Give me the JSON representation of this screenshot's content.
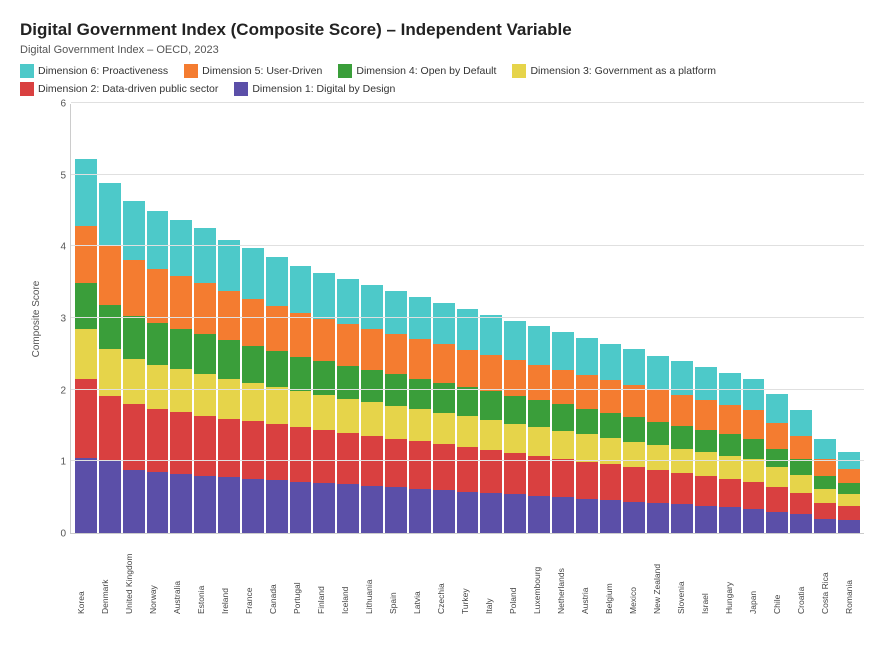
{
  "title": "Digital Government Index (Composite Score) – Independent Variable",
  "subtitle": "Digital Government Index – OECD, 2023",
  "legend": [
    {
      "label": "Dimension 6: Proactiveness",
      "color": "#4dc9c9"
    },
    {
      "label": "Dimension 5: User-Driven",
      "color": "#f47c30"
    },
    {
      "label": "Dimension 4: Open by Default",
      "color": "#3a9e3a"
    },
    {
      "label": "Dimension 3: Government as a platform",
      "color": "#e6d44a"
    },
    {
      "label": "Dimension 2: Data-driven public sector",
      "color": "#d94040"
    },
    {
      "label": "Dimension 1: Digital by Design",
      "color": "#5b4fa8"
    }
  ],
  "yAxis": {
    "label": "Composite Score",
    "ticks": [
      0,
      1,
      2,
      3,
      4,
      5,
      6
    ],
    "max": 6
  },
  "countries": [
    "Korea",
    "Denmark",
    "United Kingdom",
    "Norway",
    "Australia",
    "Estonia",
    "Ireland",
    "France",
    "Canada",
    "Portugal",
    "Finland",
    "Iceland",
    "Lithuania",
    "Spain",
    "Latvia",
    "Czechia",
    "Turkey",
    "Italy",
    "Poland",
    "Luxembourg",
    "Netherlands",
    "Austria",
    "Belgium",
    "Mexico",
    "New Zealand",
    "Slovenia",
    "Israel",
    "Hungary",
    "Japan",
    "Chile",
    "Croatia",
    "Costa Rica",
    "Romania"
  ],
  "bars": [
    {
      "country": "Korea",
      "d6": 0.93,
      "d5": 0.8,
      "d4": 0.65,
      "d3": 0.7,
      "d2": 1.1,
      "d1": 1.05
    },
    {
      "country": "Denmark",
      "d6": 0.88,
      "d5": 0.82,
      "d4": 0.62,
      "d3": 0.65,
      "d2": 0.9,
      "d1": 1.02
    },
    {
      "country": "United Kingdom",
      "d6": 0.82,
      "d5": 0.78,
      "d4": 0.6,
      "d3": 0.64,
      "d2": 0.92,
      "d1": 0.88
    },
    {
      "country": "Norway",
      "d6": 0.8,
      "d5": 0.76,
      "d4": 0.59,
      "d3": 0.62,
      "d2": 0.88,
      "d1": 0.85
    },
    {
      "country": "Australia",
      "d6": 0.78,
      "d5": 0.74,
      "d4": 0.57,
      "d3": 0.6,
      "d2": 0.86,
      "d1": 0.83
    },
    {
      "country": "Estonia",
      "d6": 0.76,
      "d5": 0.72,
      "d4": 0.56,
      "d3": 0.58,
      "d2": 0.84,
      "d1": 0.8
    },
    {
      "country": "Ireland",
      "d6": 0.72,
      "d5": 0.68,
      "d4": 0.54,
      "d3": 0.56,
      "d2": 0.82,
      "d1": 0.78
    },
    {
      "country": "France",
      "d6": 0.7,
      "d5": 0.66,
      "d4": 0.52,
      "d3": 0.54,
      "d2": 0.8,
      "d1": 0.76
    },
    {
      "country": "Canada",
      "d6": 0.68,
      "d5": 0.64,
      "d4": 0.5,
      "d3": 0.52,
      "d2": 0.78,
      "d1": 0.74
    },
    {
      "country": "Portugal",
      "d6": 0.65,
      "d5": 0.62,
      "d4": 0.48,
      "d3": 0.5,
      "d2": 0.76,
      "d1": 0.72
    },
    {
      "country": "Finland",
      "d6": 0.64,
      "d5": 0.6,
      "d4": 0.47,
      "d3": 0.49,
      "d2": 0.74,
      "d1": 0.7
    },
    {
      "country": "Iceland",
      "d6": 0.63,
      "d5": 0.58,
      "d4": 0.46,
      "d3": 0.48,
      "d2": 0.72,
      "d1": 0.68
    },
    {
      "country": "Lithuania",
      "d6": 0.62,
      "d5": 0.57,
      "d4": 0.45,
      "d3": 0.47,
      "d2": 0.7,
      "d1": 0.66
    },
    {
      "country": "Spain",
      "d6": 0.6,
      "d5": 0.56,
      "d4": 0.44,
      "d3": 0.46,
      "d2": 0.68,
      "d1": 0.64
    },
    {
      "country": "Latvia",
      "d6": 0.59,
      "d5": 0.55,
      "d4": 0.43,
      "d3": 0.45,
      "d2": 0.66,
      "d1": 0.62
    },
    {
      "country": "Czechia",
      "d6": 0.58,
      "d5": 0.54,
      "d4": 0.42,
      "d3": 0.44,
      "d2": 0.64,
      "d1": 0.6
    },
    {
      "country": "Turkey",
      "d6": 0.57,
      "d5": 0.52,
      "d4": 0.41,
      "d3": 0.43,
      "d2": 0.62,
      "d1": 0.58
    },
    {
      "country": "Italy",
      "d6": 0.56,
      "d5": 0.51,
      "d4": 0.4,
      "d3": 0.42,
      "d2": 0.6,
      "d1": 0.56
    },
    {
      "country": "Poland",
      "d6": 0.55,
      "d5": 0.5,
      "d4": 0.39,
      "d3": 0.41,
      "d2": 0.58,
      "d1": 0.54
    },
    {
      "country": "Luxembourg",
      "d6": 0.54,
      "d5": 0.49,
      "d4": 0.38,
      "d3": 0.4,
      "d2": 0.56,
      "d1": 0.52
    },
    {
      "country": "Netherlands",
      "d6": 0.53,
      "d5": 0.48,
      "d4": 0.37,
      "d3": 0.39,
      "d2": 0.54,
      "d1": 0.5
    },
    {
      "country": "Austria",
      "d6": 0.52,
      "d5": 0.47,
      "d4": 0.36,
      "d3": 0.38,
      "d2": 0.52,
      "d1": 0.48
    },
    {
      "country": "Belgium",
      "d6": 0.51,
      "d5": 0.46,
      "d4": 0.35,
      "d3": 0.37,
      "d2": 0.5,
      "d1": 0.46
    },
    {
      "country": "Mexico",
      "d6": 0.5,
      "d5": 0.45,
      "d4": 0.34,
      "d3": 0.36,
      "d2": 0.48,
      "d1": 0.44
    },
    {
      "country": "New Zealand",
      "d6": 0.48,
      "d5": 0.44,
      "d4": 0.33,
      "d3": 0.35,
      "d2": 0.46,
      "d1": 0.42
    },
    {
      "country": "Slovenia",
      "d6": 0.47,
      "d5": 0.43,
      "d4": 0.32,
      "d3": 0.34,
      "d2": 0.44,
      "d1": 0.4
    },
    {
      "country": "Israel",
      "d6": 0.46,
      "d5": 0.42,
      "d4": 0.31,
      "d3": 0.33,
      "d2": 0.42,
      "d1": 0.38
    },
    {
      "country": "Hungary",
      "d6": 0.45,
      "d5": 0.41,
      "d4": 0.3,
      "d3": 0.32,
      "d2": 0.4,
      "d1": 0.36
    },
    {
      "country": "Japan",
      "d6": 0.44,
      "d5": 0.4,
      "d4": 0.29,
      "d3": 0.31,
      "d2": 0.38,
      "d1": 0.34
    },
    {
      "country": "Chile",
      "d6": 0.4,
      "d5": 0.36,
      "d4": 0.26,
      "d3": 0.28,
      "d2": 0.34,
      "d1": 0.3
    },
    {
      "country": "Croatia",
      "d6": 0.36,
      "d5": 0.32,
      "d4": 0.23,
      "d3": 0.25,
      "d2": 0.3,
      "d1": 0.26
    },
    {
      "country": "Costa Rica",
      "d6": 0.28,
      "d5": 0.24,
      "d4": 0.18,
      "d3": 0.2,
      "d2": 0.22,
      "d1": 0.2
    },
    {
      "country": "Romania",
      "d6": 0.24,
      "d5": 0.2,
      "d4": 0.15,
      "d3": 0.17,
      "d2": 0.2,
      "d1": 0.18
    }
  ],
  "colors": {
    "d6": "#4dc9c9",
    "d5": "#f47c30",
    "d4": "#3a9e3a",
    "d3": "#e6d44a",
    "d2": "#d94040",
    "d1": "#5b4fa8"
  }
}
